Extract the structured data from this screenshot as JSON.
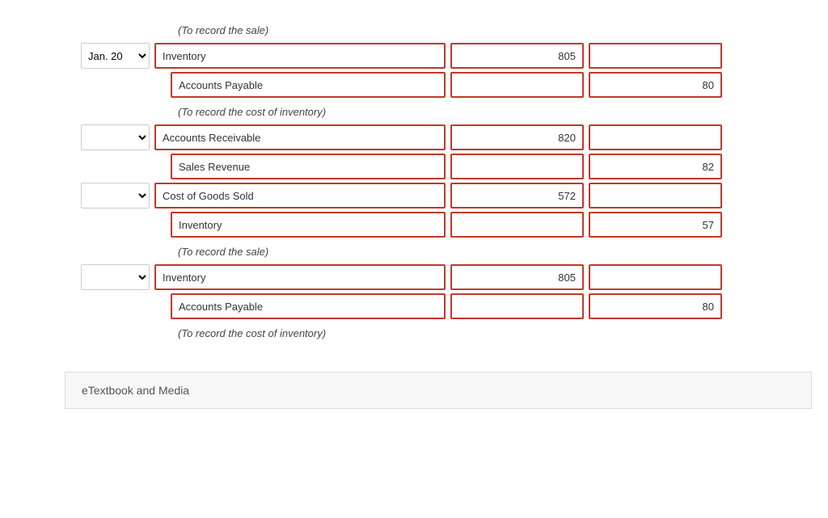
{
  "intro_label_1": "(To record the sale)",
  "intro_label_2": "(To record the cost of inventory)",
  "intro_label_3": "(To record the sale)",
  "intro_label_4": "(To record the cost of inventory)",
  "etextbook_label": "eTextbook and Media",
  "rows": [
    {
      "date": "Jan. 20",
      "show_date": true,
      "account": "Inventory",
      "debit": "805",
      "credit": "",
      "indented": false
    },
    {
      "date": "",
      "show_date": false,
      "account": "Accounts Payable",
      "debit": "",
      "credit": "80",
      "indented": true
    },
    {
      "date": "",
      "show_date": true,
      "account": "Accounts Receivable",
      "debit": "820",
      "credit": "",
      "indented": false
    },
    {
      "date": "",
      "show_date": false,
      "account": "Sales Revenue",
      "debit": "",
      "credit": "82",
      "indented": true
    },
    {
      "date": "",
      "show_date": true,
      "account": "Cost of Goods Sold",
      "debit": "572",
      "credit": "",
      "indented": false
    },
    {
      "date": "",
      "show_date": false,
      "account": "Inventory",
      "debit": "",
      "credit": "57",
      "indented": true
    },
    {
      "date": "",
      "show_date": true,
      "account": "Inventory",
      "debit": "805",
      "credit": "",
      "indented": false
    },
    {
      "date": "",
      "show_date": false,
      "account": "Accounts Payable",
      "debit": "",
      "credit": "80",
      "indented": true
    }
  ]
}
